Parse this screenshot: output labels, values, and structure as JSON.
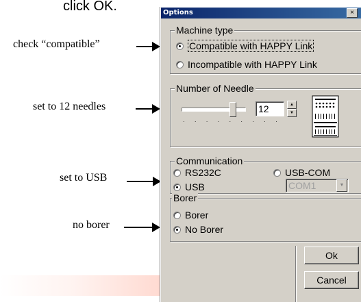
{
  "intro_text": "click OK.",
  "annotations": {
    "compatible": "check “compatible”",
    "needles": "set to 12 needles",
    "usb": "set to USB",
    "borer": "no borer"
  },
  "dialog": {
    "title": "Options",
    "close_glyph": "×",
    "machine_type": {
      "label": "Machine type",
      "options": [
        "Compatible with HAPPY Link",
        "Incompatible with HAPPY Link"
      ],
      "selected": 0
    },
    "needle": {
      "label": "Number of Needle",
      "value": "12",
      "slider_level": 0.85
    },
    "communication": {
      "label": "Communication",
      "options": [
        "RS232C",
        "USB-COM",
        "USB"
      ],
      "selected": "USB",
      "com_port": "COM1"
    },
    "borer": {
      "label": "Borer",
      "options": [
        "Borer",
        "No Borer"
      ],
      "selected": 1
    },
    "buttons": {
      "ok": "Ok",
      "cancel": "Cancel"
    }
  },
  "colors": {
    "title_start": "#0a246a",
    "title_end": "#3a6ea5",
    "face": "#d4d0c8"
  }
}
